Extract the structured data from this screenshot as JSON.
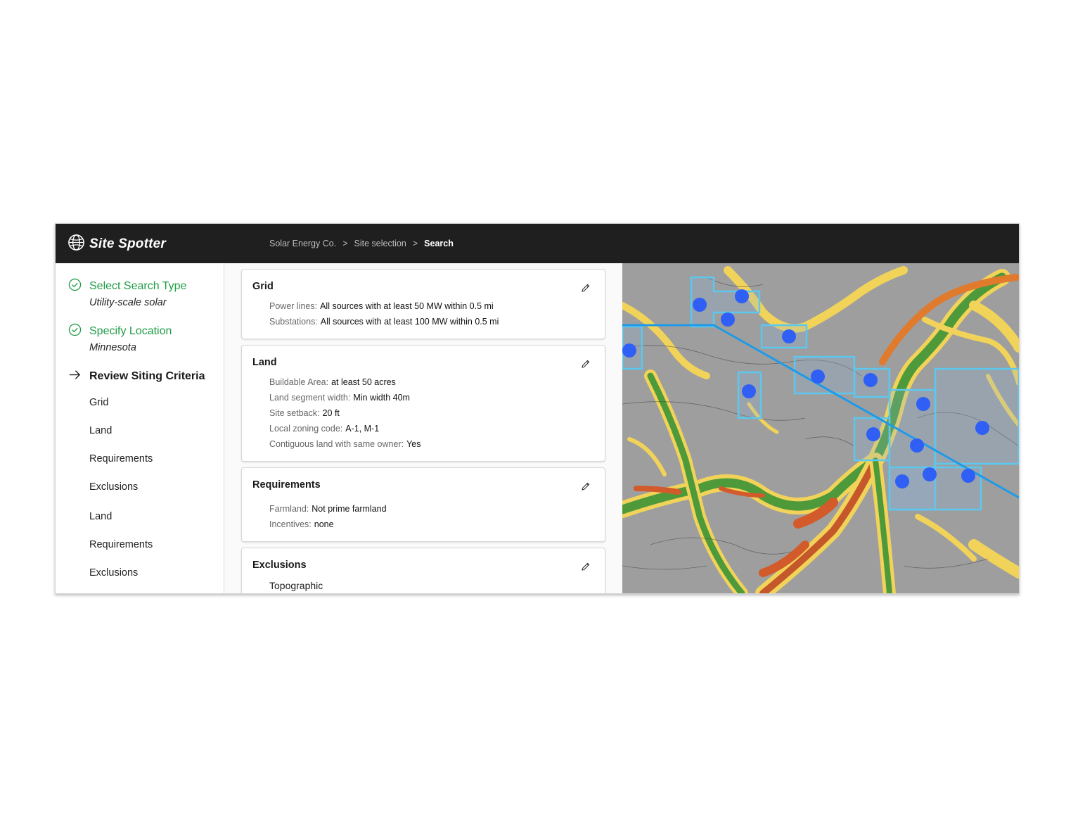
{
  "app": {
    "name": "Site Spotter"
  },
  "breadcrumb": {
    "items": [
      "Solar Energy Co.",
      ">",
      "Site selection",
      ">"
    ],
    "current": "Search"
  },
  "steps": {
    "s1": {
      "title": "Select Search Type",
      "value": "Utility-scale solar"
    },
    "s2": {
      "title": "Specify Location",
      "value": "Minnesota"
    },
    "s3": {
      "title": "Review Siting Criteria"
    },
    "subitems": [
      "Grid",
      "Land",
      "Requirements",
      "Exclusions",
      "Land",
      "Requirements",
      "Exclusions"
    ]
  },
  "cards": {
    "grid": {
      "title": "Grid",
      "rows": [
        {
          "label": "Power lines:",
          "value": "All sources with at least 50 MW within 0.5 mi"
        },
        {
          "label": "Substations:",
          "value": "All sources with at least 100 MW within 0.5 mi"
        }
      ]
    },
    "land": {
      "title": "Land",
      "rows": [
        {
          "label": "Buildable Area:",
          "value": "at least 50 acres"
        },
        {
          "label": "Land segment width:",
          "value": "Min width 40m"
        },
        {
          "label": "Site setback:",
          "value": "20 ft"
        },
        {
          "label": "Local zoning code:",
          "value": "A-1, M-1"
        },
        {
          "label": "Contiguous land with same owner:",
          "value": "Yes"
        }
      ]
    },
    "requirements": {
      "title": "Requirements",
      "rows": [
        {
          "label": "Farmland:",
          "value": "Not prime farmland"
        },
        {
          "label": "Incentives:",
          "value": "none"
        }
      ]
    },
    "exclusions": {
      "title": "Exclusions",
      "subsection": "Topographic"
    }
  },
  "colors": {
    "success": "#1f9d47",
    "topbar": "#1f1f1f",
    "site_marker": "#2f5ff5",
    "parcel_outline": "#5bc8ef",
    "power_line": "#1e9be8"
  }
}
